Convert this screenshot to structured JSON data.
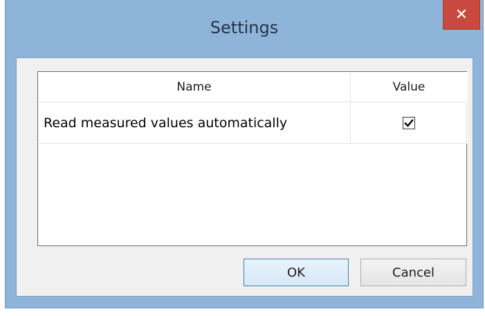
{
  "window": {
    "title": "Settings",
    "close_glyph": "✕"
  },
  "grid": {
    "columns": [
      {
        "label": "Name"
      },
      {
        "label": "Value"
      }
    ],
    "rows": [
      {
        "name": "Read measured values automatically",
        "checked": true
      }
    ]
  },
  "buttons": {
    "ok_label": "OK",
    "cancel_label": "Cancel"
  },
  "icons": {
    "close": "close-icon",
    "checkmark": "checkmark-icon"
  },
  "colors": {
    "titlebar": "#8fb4d9",
    "close_button": "#c84a3e",
    "ok_border": "#3c7fb1"
  }
}
